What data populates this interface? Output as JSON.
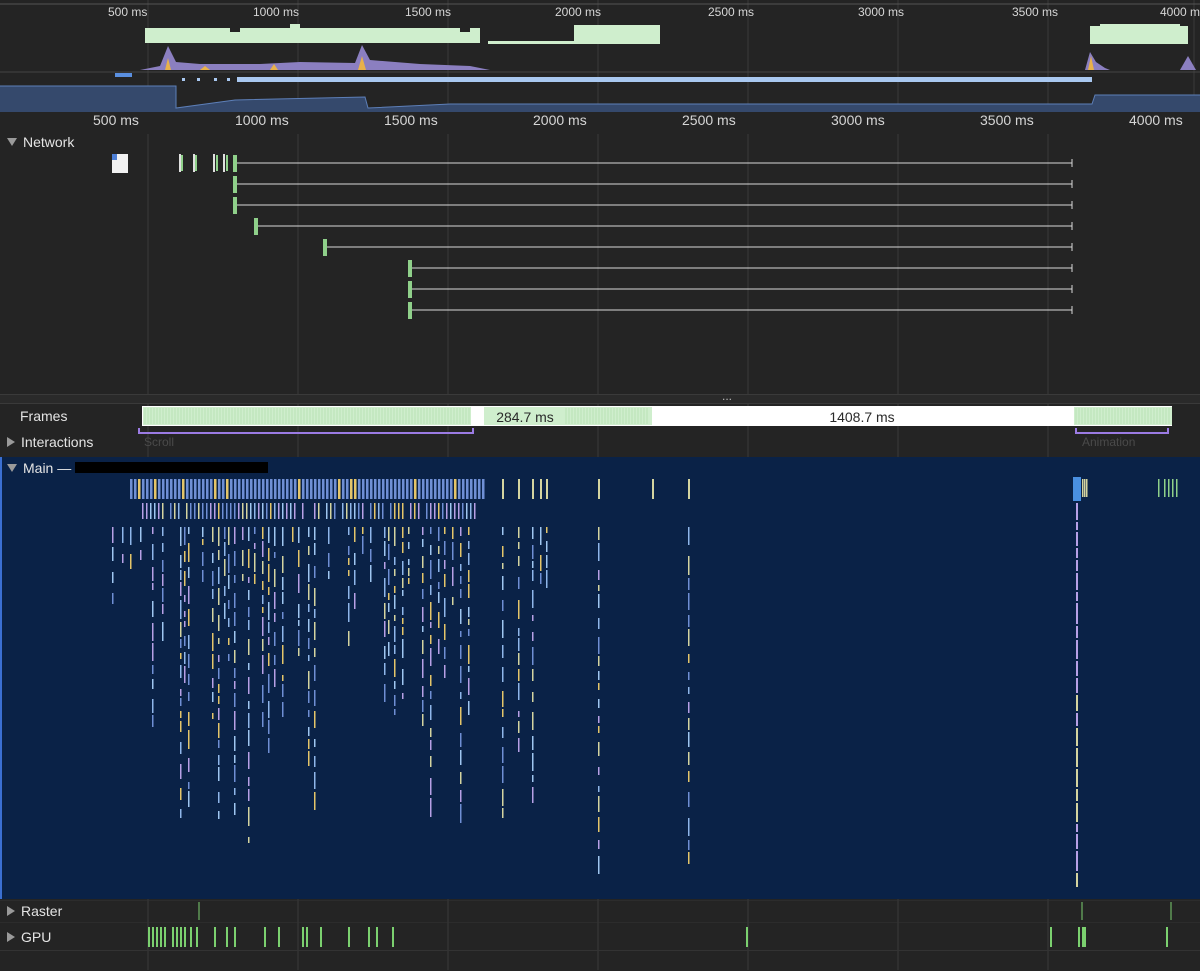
{
  "overview_ruler": {
    "ticks": [
      "500 ms",
      "1000 ms",
      "1500 ms",
      "2000 ms",
      "2500 ms",
      "3000 ms",
      "3500 ms",
      "4000 m"
    ]
  },
  "main_ruler": {
    "ticks": [
      "500 ms",
      "1000 ms",
      "1500 ms",
      "2000 ms",
      "2500 ms",
      "3000 ms",
      "3500 ms",
      "4000 ms"
    ]
  },
  "tracks": {
    "network": {
      "label": "Network"
    },
    "frames": {
      "label": "Frames",
      "frame_a": "284.7 ms",
      "frame_b": "1408.7 ms"
    },
    "interactions": {
      "label": "Interactions",
      "scroll": "Scroll",
      "animation": "Animation"
    },
    "main": {
      "label": "Main —"
    },
    "raster": {
      "label": "Raster"
    },
    "gpu": {
      "label": "GPU"
    }
  },
  "splitter": {
    "glyph": "..."
  },
  "colors": {
    "background": "#242424",
    "main_panel": "#0a2247",
    "frame_green": "#cfeecd",
    "interaction_purple": "#9b7be3",
    "network_line": "#d9d9d9",
    "gpu_green": "#7bd06f",
    "selection_blue": "#a9c8f0"
  }
}
